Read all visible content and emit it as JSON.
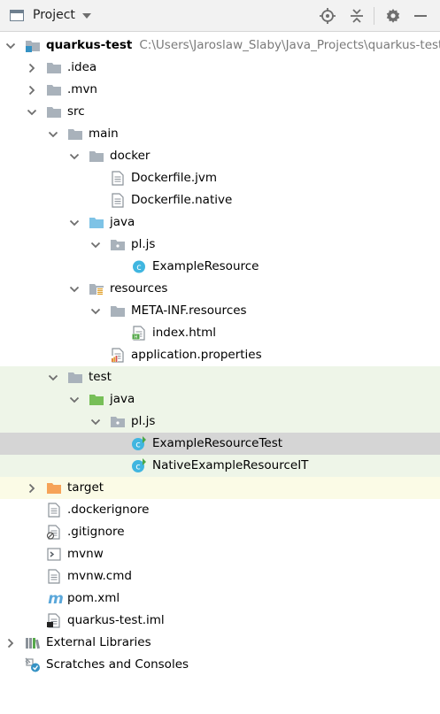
{
  "toolbar": {
    "title": "Project",
    "icons": [
      "panel-icon",
      "chevron-down-icon",
      "locate-icon",
      "collapse-all-icon",
      "gear-icon",
      "minimize-icon"
    ]
  },
  "tree": [
    {
      "label": "quarkus-test",
      "path": "C:\\Users\\Jaroslaw_Slaby\\Java_Projects\\quarkus-test",
      "icon": "module-folder-icon",
      "expanded": true
    },
    {
      "label": ".idea",
      "icon": "folder-icon",
      "expanded": false
    },
    {
      "label": ".mvn",
      "icon": "folder-icon",
      "expanded": false
    },
    {
      "label": "src",
      "icon": "folder-icon",
      "expanded": true
    },
    {
      "label": "main",
      "icon": "folder-icon",
      "expanded": true
    },
    {
      "label": "docker",
      "icon": "folder-icon",
      "expanded": true
    },
    {
      "label": "Dockerfile.jvm",
      "icon": "text-file-icon"
    },
    {
      "label": "Dockerfile.native",
      "icon": "text-file-icon"
    },
    {
      "label": "java",
      "icon": "source-root-icon",
      "expanded": true
    },
    {
      "label": "pl.js",
      "icon": "package-icon",
      "expanded": true
    },
    {
      "label": "ExampleResource",
      "icon": "java-class-icon"
    },
    {
      "label": "resources",
      "icon": "resources-root-icon",
      "expanded": true
    },
    {
      "label": "META-INF.resources",
      "icon": "folder-icon",
      "expanded": true
    },
    {
      "label": "index.html",
      "icon": "html-file-icon"
    },
    {
      "label": "application.properties",
      "icon": "properties-file-icon"
    },
    {
      "label": "test",
      "icon": "folder-icon",
      "expanded": true
    },
    {
      "label": "java",
      "icon": "test-root-icon",
      "expanded": true
    },
    {
      "label": "pl.js",
      "icon": "package-icon",
      "expanded": true
    },
    {
      "label": "ExampleResourceTest",
      "icon": "test-class-icon",
      "selected": true
    },
    {
      "label": "NativeExampleResourceIT",
      "icon": "test-class-icon"
    },
    {
      "label": "target",
      "icon": "excluded-folder-icon",
      "expanded": false
    },
    {
      "label": ".dockerignore",
      "icon": "text-file-icon"
    },
    {
      "label": ".gitignore",
      "icon": "ignore-file-icon"
    },
    {
      "label": "mvnw",
      "icon": "shell-script-icon"
    },
    {
      "label": "mvnw.cmd",
      "icon": "text-file-icon"
    },
    {
      "label": "pom.xml",
      "icon": "maven-icon"
    },
    {
      "label": "quarkus-test.iml",
      "icon": "iml-file-icon"
    },
    {
      "label": "External Libraries",
      "icon": "libraries-icon",
      "expanded": false
    },
    {
      "label": "Scratches and Consoles",
      "icon": "scratches-icon"
    }
  ],
  "colors": {
    "selection": "#d5d5d5",
    "test_highlight": "#eef5e8",
    "excluded_highlight": "#fbfbe6",
    "folder": "#a9b2bb",
    "source_root": "#7ec3e6",
    "test_root": "#77bf58",
    "excluded": "#f6a358",
    "class": "#40b6e0"
  }
}
